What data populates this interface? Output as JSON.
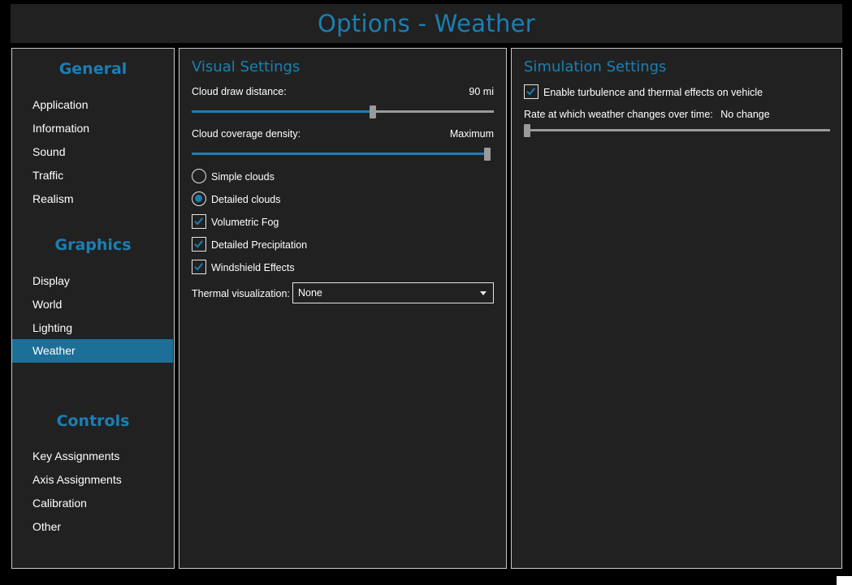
{
  "header": {
    "title": "Options - Weather"
  },
  "nav": {
    "sections": [
      {
        "heading": "General",
        "items": [
          "Application",
          "Information",
          "Sound",
          "Traffic",
          "Realism"
        ]
      },
      {
        "heading": "Graphics",
        "items": [
          "Display",
          "World",
          "Lighting",
          "Weather"
        ]
      },
      {
        "heading": "Controls",
        "items": [
          "Key Assignments",
          "Axis Assignments",
          "Calibration",
          "Other"
        ]
      }
    ],
    "active_item": "Weather"
  },
  "visual": {
    "title": "Visual Settings",
    "cloud_distance": {
      "label": "Cloud draw distance:",
      "value": "90 mi",
      "level": 0.6
    },
    "cloud_density": {
      "label": "Cloud coverage density:",
      "value": "Maximum",
      "level": 1.0
    },
    "radios": [
      {
        "label": "Simple clouds",
        "checked": false
      },
      {
        "label": "Detailed clouds",
        "checked": true
      }
    ],
    "checkboxes": [
      {
        "label": "Volumetric Fog",
        "checked": true
      },
      {
        "label": "Detailed Precipitation",
        "checked": true
      },
      {
        "label": "Windshield Effects",
        "checked": true
      }
    ],
    "thermal": {
      "label": "Thermal visualization:",
      "value": "None"
    }
  },
  "simulation": {
    "title": "Simulation Settings",
    "turbulence": {
      "label": "Enable turbulence and thermal effects on vehicle",
      "checked": true
    },
    "weather_rate": {
      "label": "Rate at which weather changes over time:",
      "value": "No change",
      "level": 0.0
    }
  },
  "colors": {
    "accent": "#1b7fb3",
    "active_bg": "#1c6f97",
    "panel_bg": "#212121",
    "border": "#c8c8c8"
  }
}
